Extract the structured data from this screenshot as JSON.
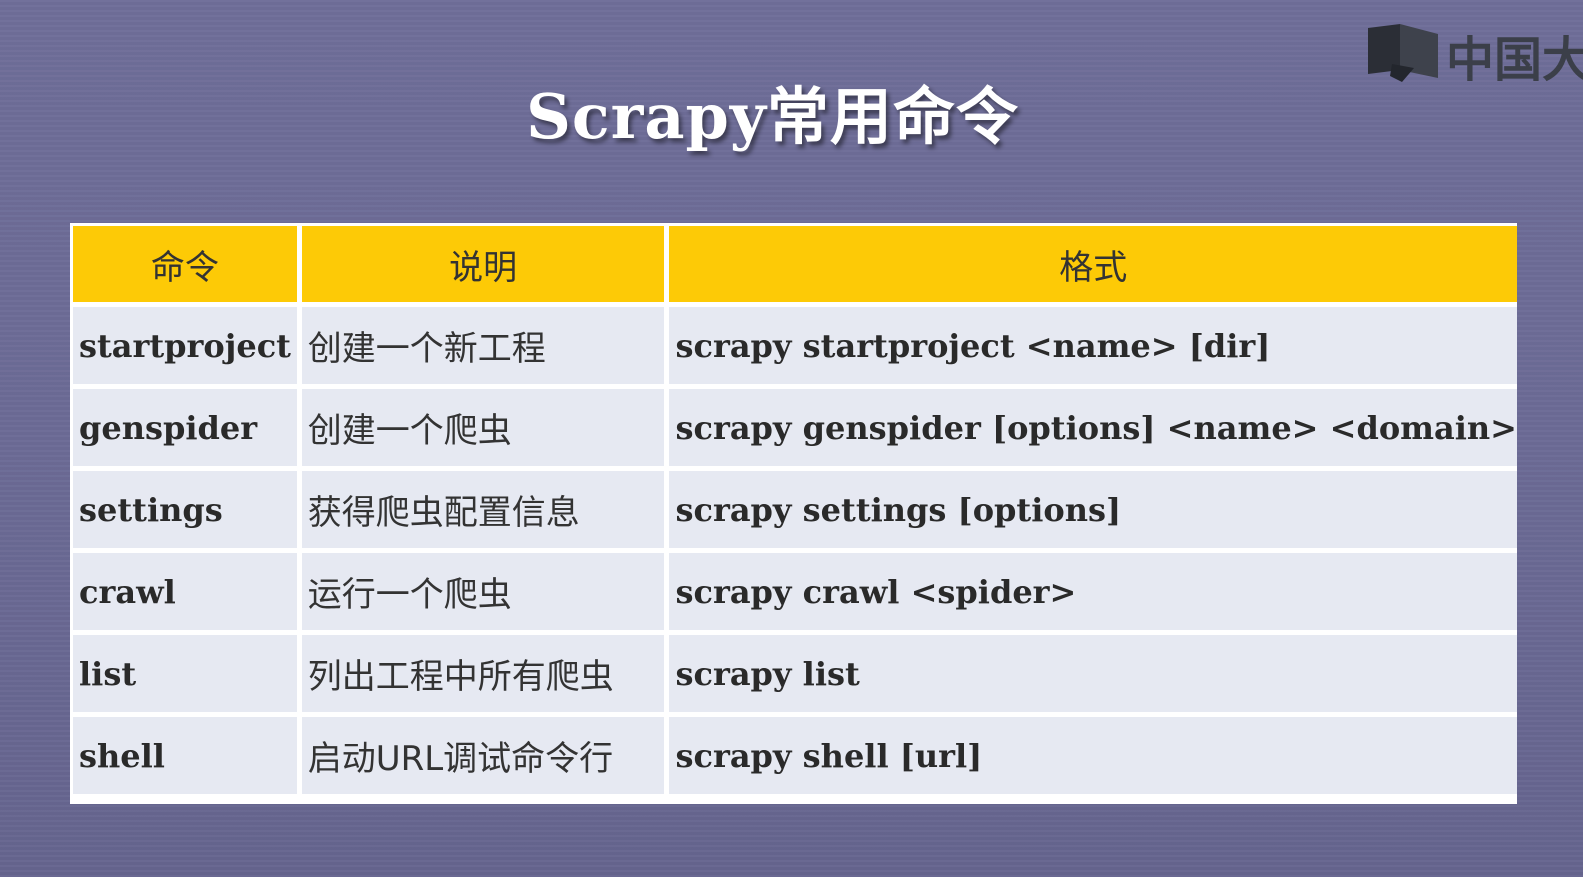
{
  "slide": {
    "title": "Scrapy常用命令"
  },
  "logo": {
    "text": "中国大",
    "icon": "book-icon"
  },
  "table": {
    "headers": [
      "命令",
      "说明",
      "格式"
    ],
    "rows": [
      {
        "command": "startproject",
        "description": "创建一个新工程",
        "format": "scrapy startproject <name> [dir]"
      },
      {
        "command": "genspider",
        "description": "创建一个爬虫",
        "format": "scrapy genspider [options] <name> <domain>"
      },
      {
        "command": "settings",
        "description": "获得爬虫配置信息",
        "format": "scrapy settings [options]"
      },
      {
        "command": "crawl",
        "description": "运行一个爬虫",
        "format": "scrapy crawl <spider>"
      },
      {
        "command": "list",
        "description": "列出工程中所有爬虫",
        "format": "scrapy list"
      },
      {
        "command": "shell",
        "description": "启动URL调试命令行",
        "format": "scrapy shell [url]"
      }
    ]
  },
  "colors": {
    "header_bg": "#fdca06",
    "cell_bg": "#e6e9f2",
    "slide_bg": "#6d6c97",
    "title_text": "#ffffff"
  }
}
